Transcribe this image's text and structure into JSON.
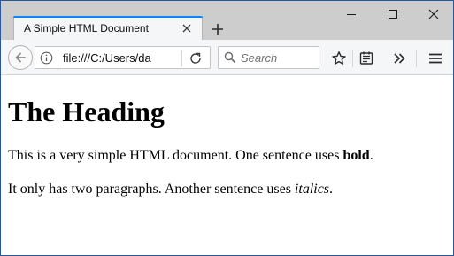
{
  "tab": {
    "title": "A Simple HTML Document"
  },
  "navbar": {
    "url": "file:///C:/Users/da",
    "search_placeholder": "Search"
  },
  "content": {
    "heading": "The Heading",
    "paragraph1": {
      "text": "This is a very simple HTML document. One sentence uses ",
      "bold": "bold",
      "end": "."
    },
    "paragraph2": {
      "text": "It only has two paragraphs. Another sentence uses ",
      "italic": "italics",
      "end": "."
    }
  },
  "colors": {
    "accent": "#0a84ff",
    "titlebar": "#cdcdcd",
    "toolbar": "#f5f6f7",
    "window_border": "#2b5797"
  },
  "icons": [
    "close-icon",
    "plus-icon",
    "minimize-icon",
    "maximize-icon",
    "back-arrow-icon",
    "info-icon",
    "reload-icon",
    "search-icon",
    "star-icon",
    "reader-icon",
    "overflow-icon",
    "hamburger-menu-icon"
  ]
}
